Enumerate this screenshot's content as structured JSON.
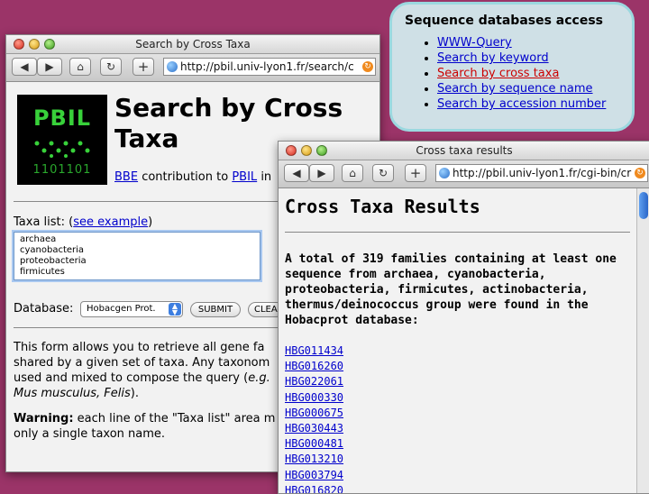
{
  "panel": {
    "title": "Sequence databases access",
    "links": [
      "WWW-Query",
      "Search by keyword",
      "Search by cross taxa",
      "Search by sequence name",
      "Search by accession number"
    ],
    "active_index": 2
  },
  "window1": {
    "title": "Search by Cross Taxa",
    "url": "http://pbil.univ-lyon1.fr/search/c",
    "logo": {
      "text": "PBIL",
      "bits": "1101101"
    },
    "heading": "Search by Cross Taxa",
    "contrib": {
      "link1": "BBE",
      "mid": "contribution to",
      "link2": "PBIL",
      "tail": "in"
    },
    "taxa_label": "Taxa list:",
    "taxa_example_link": "see example",
    "taxa_values": [
      "archaea",
      "cyanobacteria",
      "proteobacteria",
      "firmicutes"
    ],
    "database_label": "Database:",
    "database_selected": "Hobacgen Prot.",
    "submit_label": "SUBMIT",
    "clear_label": "CLEA",
    "desc_lines": [
      "This form allows you to retrieve all gene fa",
      "shared by a given set of taxa. Any taxonom",
      "used and mixed to compose the query ("
    ],
    "desc_eg": "e.g.",
    "desc_italic_line": "Mus musculus, Felis",
    "desc_close": ").",
    "warning_label": "Warning:",
    "warning_line1": "each line of the \"Taxa list\" area m",
    "warning_line2": "only a single taxon name."
  },
  "window2": {
    "title": "Cross taxa results",
    "url": "http://pbil.univ-lyon1.fr/cgi-bin/cr",
    "heading": "Cross Taxa Results",
    "summary": "A total of 319 families containing at least one sequence from archaea, cyanobacteria, proteobacteria, firmicutes, actinobacteria, thermus/deinococcus group were found in the Hobacprot database:",
    "results": [
      "HBG011434",
      "HBG016260",
      "HBG022061",
      "HBG000330",
      "HBG000675",
      "HBG030443",
      "HBG000481",
      "HBG013210",
      "HBG003794",
      "HBG016820"
    ]
  },
  "toolbar_icons": [
    "back-icon",
    "forward-icon",
    "home-icon",
    "reload-icon",
    "add-bookmark-icon"
  ],
  "colors": {
    "desktop": "#9b3468",
    "panel_bg": "#cfe0e6",
    "panel_border": "#9bd8df",
    "link": "#0000cc",
    "active_link": "#cc0000",
    "logo_green": "#38d13a"
  }
}
